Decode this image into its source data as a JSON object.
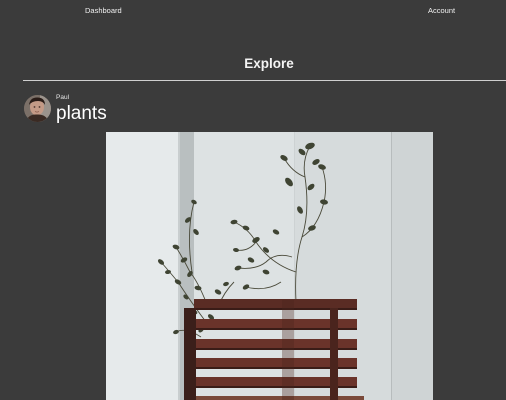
{
  "nav": {
    "dashboard_label": "Dashboard",
    "account_label": "Account"
  },
  "page": {
    "title": "Explore"
  },
  "post": {
    "author": "Paul",
    "title": "plants",
    "image_subject": "potted-plant-photo"
  },
  "colors": {
    "background": "#3b3b3b",
    "text": "#ffffff",
    "divider": "#cfcfcf"
  }
}
